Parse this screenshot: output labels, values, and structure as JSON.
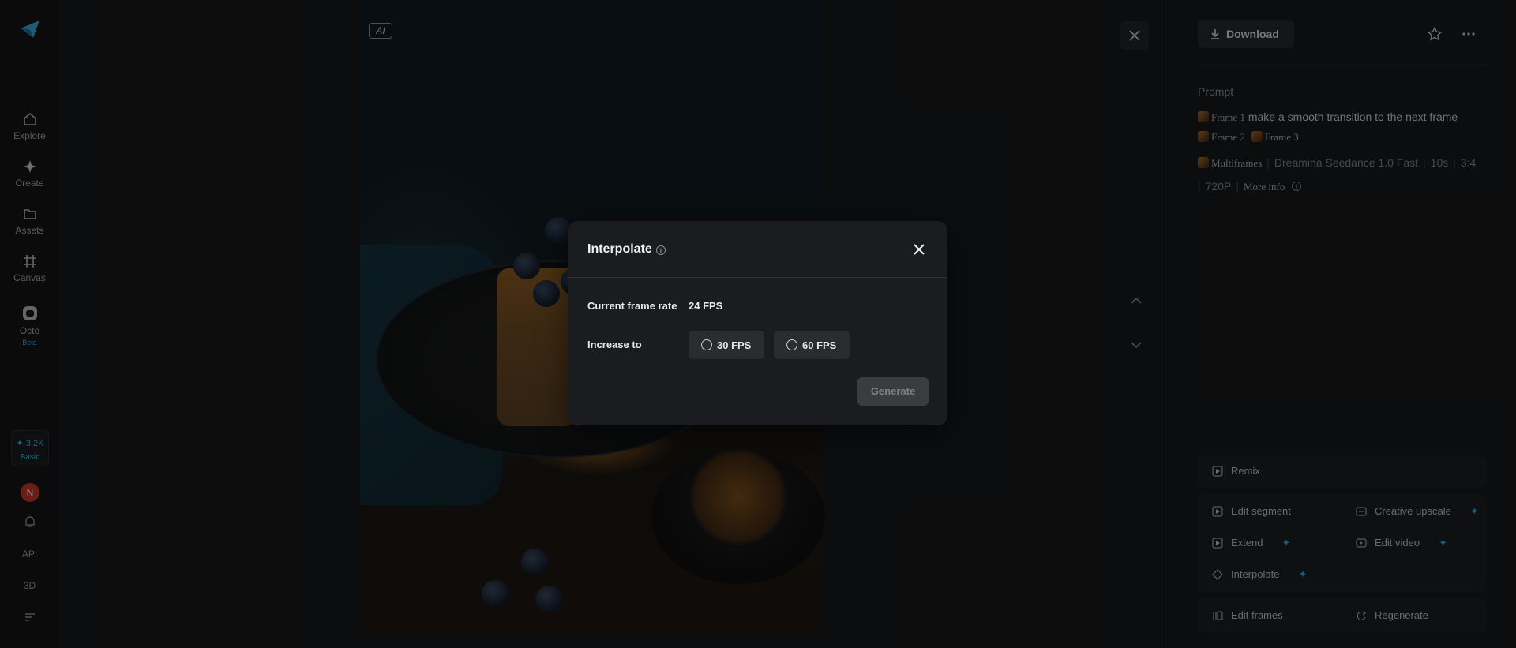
{
  "sidebar": {
    "items": [
      {
        "label": "Explore",
        "icon": "home-icon"
      },
      {
        "label": "Create",
        "icon": "sparkle-icon"
      },
      {
        "label": "Assets",
        "icon": "folder-icon"
      },
      {
        "label": "Canvas",
        "icon": "canvas-icon"
      },
      {
        "label": "Octo",
        "icon": "octo-icon",
        "badge": "Beta"
      }
    ],
    "credits": {
      "value": "3.2K",
      "tier": "Basic"
    },
    "avatar_initial": "N",
    "api_label": "API",
    "three_d_label": "3D"
  },
  "viewer": {
    "ai_badge": "AI"
  },
  "right_panel": {
    "download_label": "Download",
    "prompt_title": "Prompt",
    "prompt": {
      "frame1": "Frame 1",
      "text": "make a smooth transition to the next frame",
      "frame2": "Frame 2",
      "frame3": "Frame 3"
    },
    "meta": {
      "mode": "Multiframes",
      "model": "Dreamina Seedance 1.0 Fast",
      "duration": "10s",
      "ratio": "3:4",
      "resolution": "720P",
      "more_info": "More info"
    },
    "actions": {
      "remix": "Remix",
      "edit_segment": "Edit segment",
      "creative_upscale": "Creative upscale",
      "extend": "Extend",
      "edit_video": "Edit video",
      "interpolate": "Interpolate",
      "edit_frames": "Edit frames",
      "regenerate": "Regenerate"
    }
  },
  "modal": {
    "title": "Interpolate",
    "current_label": "Current frame rate",
    "current_value": "24 FPS",
    "increase_label": "Increase to",
    "options": [
      "30 FPS",
      "60 FPS"
    ],
    "generate_label": "Generate"
  },
  "colors": {
    "accent": "#2fb3e3",
    "avatar": "#c0382b"
  }
}
